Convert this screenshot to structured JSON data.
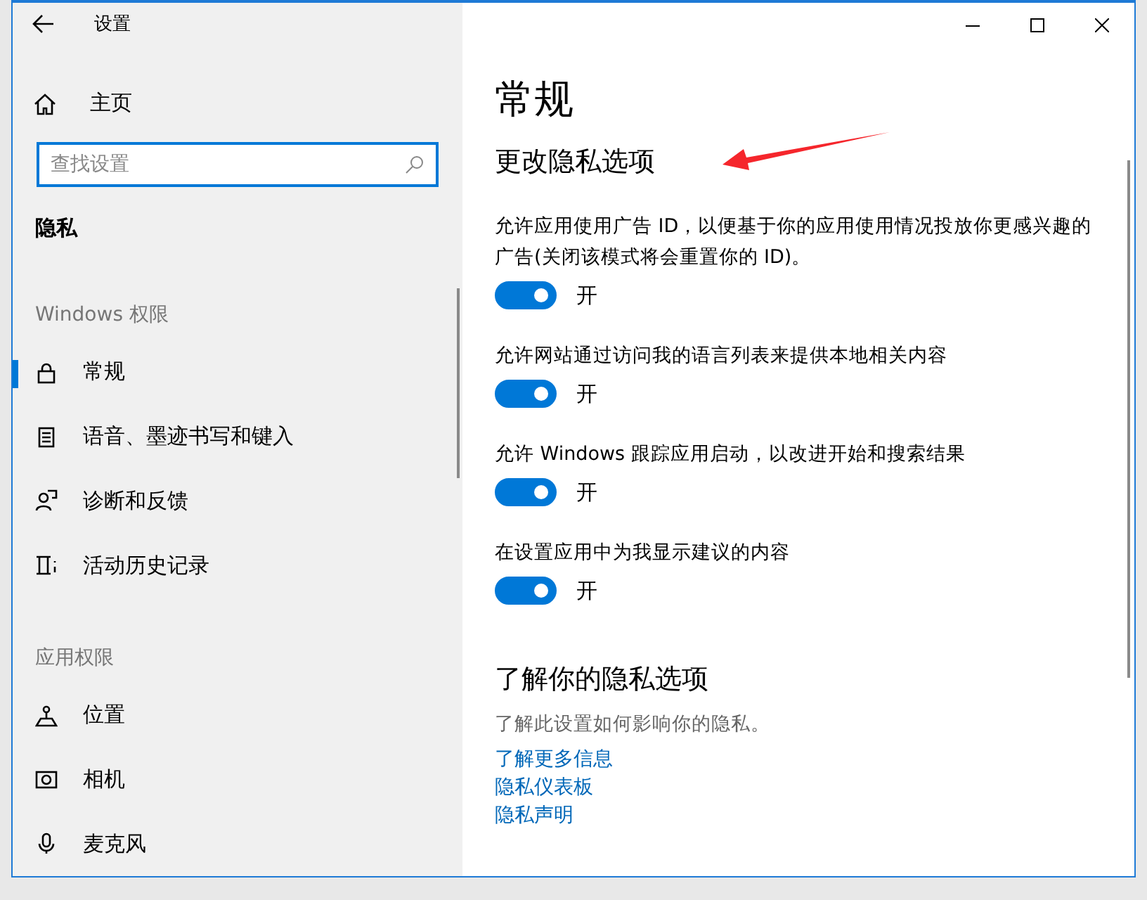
{
  "window": {
    "title": "设置"
  },
  "sidebar": {
    "home": "主页",
    "search": {
      "placeholder": "查找设置"
    },
    "section": "隐私",
    "groups": [
      {
        "title": "Windows 权限",
        "items": [
          {
            "label": "常规",
            "selected": true
          },
          {
            "label": "语音、墨迹书写和键入",
            "selected": false
          },
          {
            "label": "诊断和反馈",
            "selected": false
          },
          {
            "label": "活动历史记录",
            "selected": false
          }
        ]
      },
      {
        "title": "应用权限",
        "items": [
          {
            "label": "位置",
            "selected": false
          },
          {
            "label": "相机",
            "selected": false
          },
          {
            "label": "麦克风",
            "selected": false
          }
        ]
      }
    ]
  },
  "content": {
    "title": "常规",
    "heading": "更改隐私选项",
    "settings": [
      {
        "description": "允许应用使用广告 ID，以便基于你的应用使用情况投放你更感兴趣的广告(关闭该模式将会重置你的 ID)。",
        "on": true,
        "state_label": "开"
      },
      {
        "description": "允许网站通过访问我的语言列表来提供本地相关内容",
        "on": true,
        "state_label": "开"
      },
      {
        "description": "允许 Windows 跟踪应用启动，以改进开始和搜索结果",
        "on": true,
        "state_label": "开"
      },
      {
        "description": "在设置应用中为我显示建议的内容",
        "on": true,
        "state_label": "开"
      }
    ],
    "info": {
      "heading": "了解你的隐私选项",
      "text": "了解此设置如何影响你的隐私。",
      "links": [
        "了解更多信息",
        "隐私仪表板",
        "隐私声明"
      ]
    }
  }
}
